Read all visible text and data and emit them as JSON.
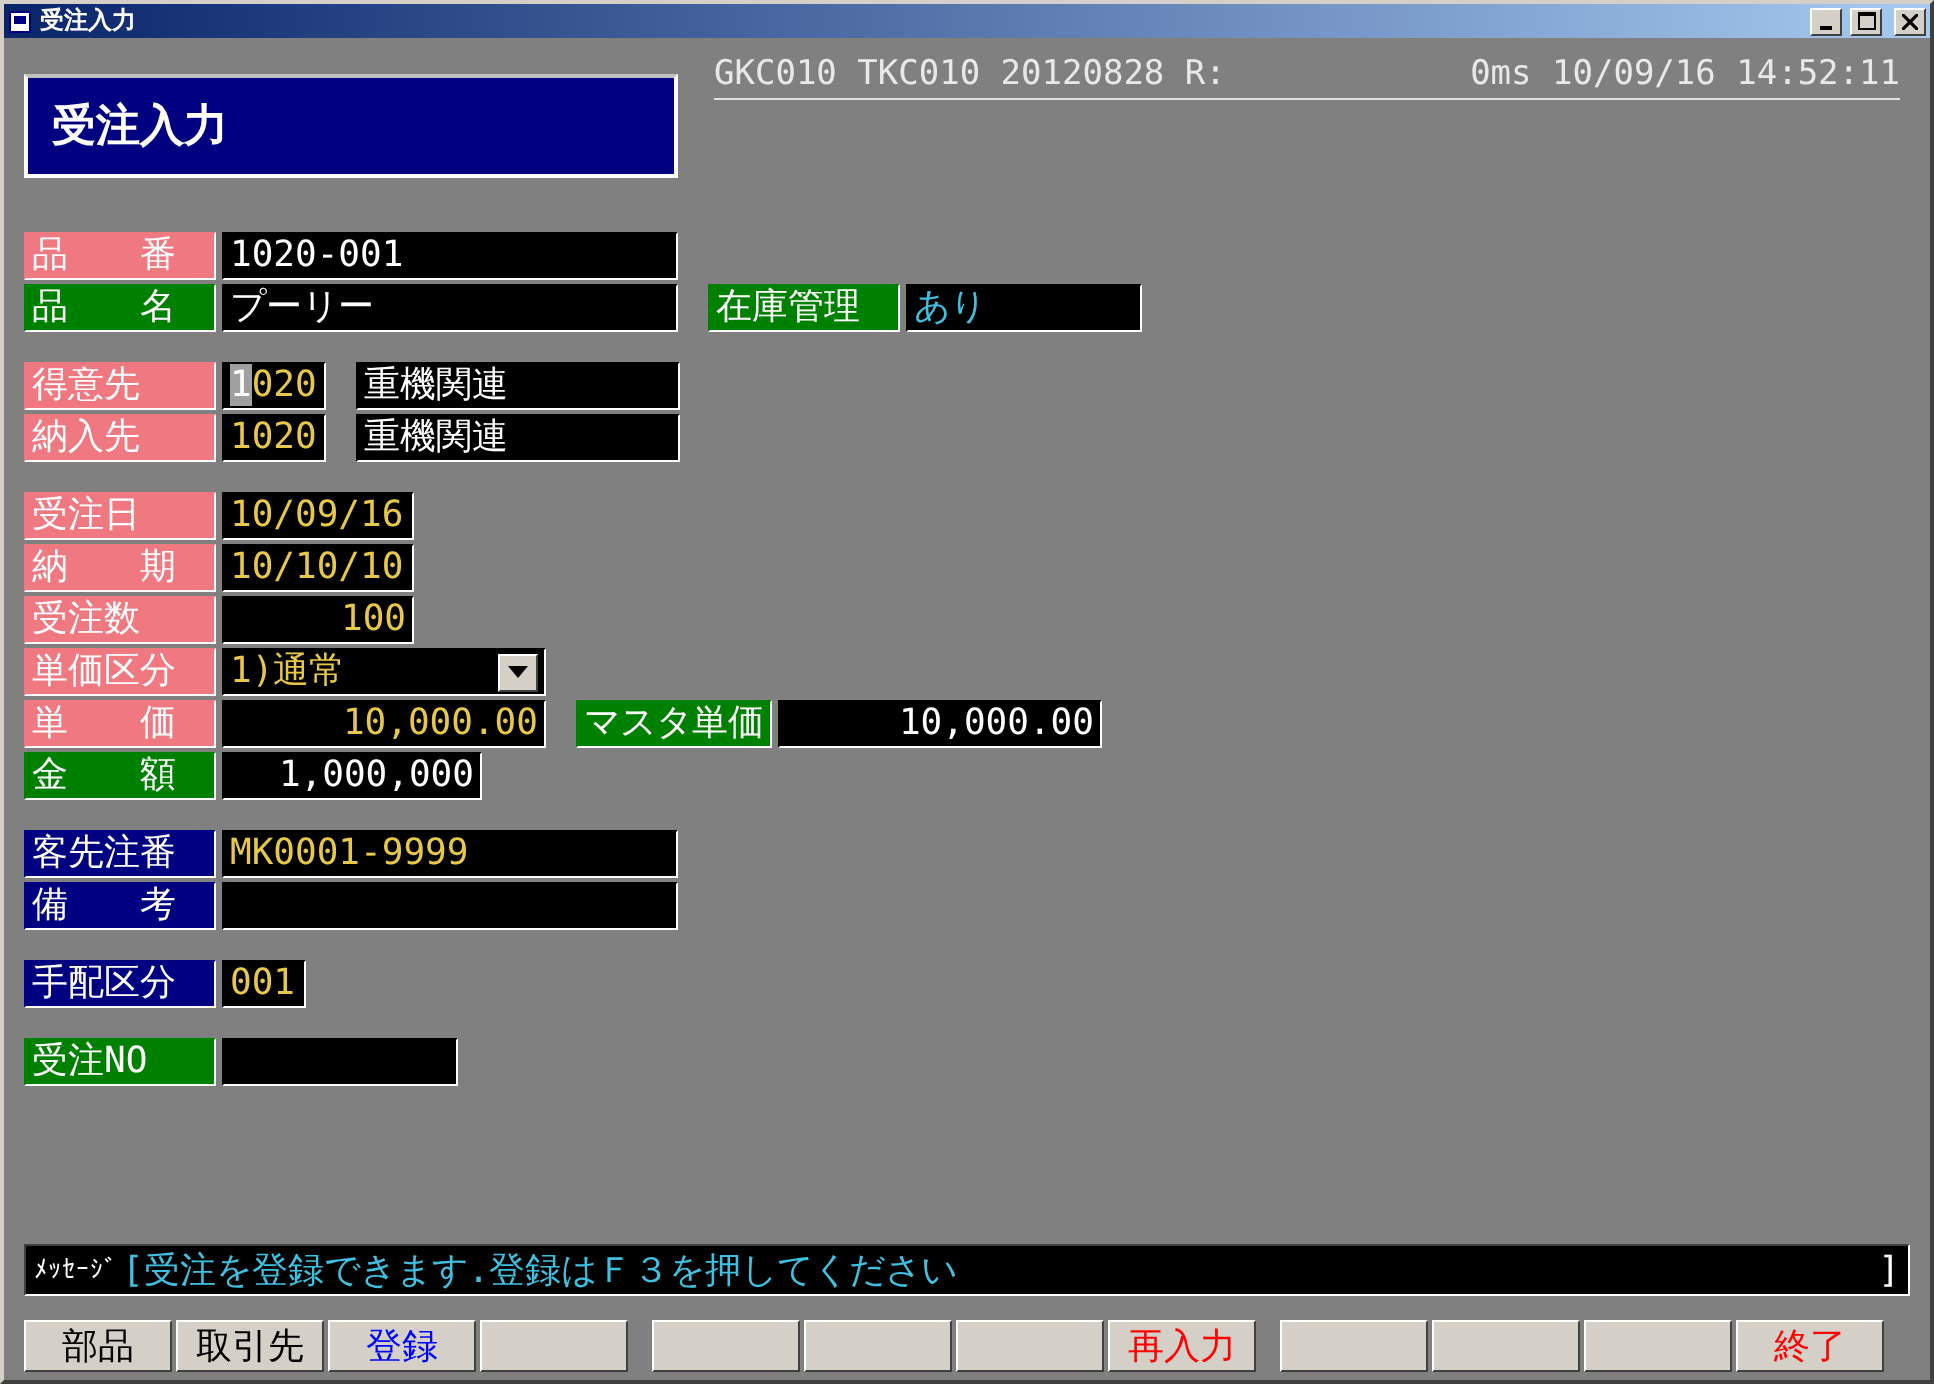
{
  "window": {
    "title": "受注入力"
  },
  "header": {
    "title": "受注入力",
    "status_left": "GKC010 TKC010 20120828 R:",
    "status_right": "0ms 10/09/16 14:52:11"
  },
  "groups": [
    [
      {
        "cells": [
          {
            "kind": "label",
            "text": "品　　番",
            "color": "#f07880"
          },
          {
            "kind": "long",
            "text": "1020-001",
            "color": "#ffffff"
          }
        ]
      },
      {
        "cells": [
          {
            "kind": "label",
            "text": "品　　名",
            "color": "#008000"
          },
          {
            "kind": "long",
            "text": "プーリー",
            "color": "#ffffff"
          },
          {
            "kind": "label",
            "text": "在庫管理",
            "color": "#008000"
          },
          {
            "kind": "flag",
            "text": "あり",
            "color": "#40c0e0"
          }
        ]
      }
    ],
    [
      {
        "cells": [
          {
            "kind": "label",
            "text": "得意先",
            "color": "#f07880"
          },
          {
            "kind": "code",
            "text": "1020",
            "color": "#e8c848",
            "cursor": true
          },
          {
            "kind": "name",
            "text": "重機関連",
            "color": "#ffffff"
          }
        ]
      },
      {
        "cells": [
          {
            "kind": "label",
            "text": "納入先",
            "color": "#f07880"
          },
          {
            "kind": "code",
            "text": "1020",
            "color": "#e8c848",
            "cursor": false
          },
          {
            "kind": "name",
            "text": "重機関連",
            "color": "#ffffff"
          }
        ]
      }
    ],
    [
      {
        "cells": [
          {
            "kind": "label",
            "text": "受注日",
            "color": "#f07880"
          },
          {
            "kind": "date",
            "text": "10/09/16",
            "color": "#e8c848"
          }
        ]
      },
      {
        "cells": [
          {
            "kind": "label",
            "text": "納　　期",
            "color": "#f07880"
          },
          {
            "kind": "date",
            "text": "10/10/10",
            "color": "#e8c848"
          }
        ]
      },
      {
        "cells": [
          {
            "kind": "label",
            "text": "受注数",
            "color": "#f07880"
          },
          {
            "kind": "quantity",
            "text": "100",
            "color": "#e8c848"
          }
        ]
      },
      {
        "cells": [
          {
            "kind": "label",
            "text": "単価区分",
            "color": "#f07880"
          },
          {
            "kind": "select",
            "text": "1)通常",
            "color": "#e8c848"
          }
        ]
      },
      {
        "cells": [
          {
            "kind": "label",
            "text": "単　　価",
            "color": "#f07880"
          },
          {
            "kind": "price",
            "text": "10,000.00",
            "color": "#e8c848"
          },
          {
            "kind": "label",
            "text": "マスタ単価",
            "color": "#008000"
          },
          {
            "kind": "price",
            "text": "10,000.00",
            "color": "#ffffff"
          }
        ]
      },
      {
        "cells": [
          {
            "kind": "label",
            "text": "金　　額",
            "color": "#008000"
          },
          {
            "kind": "total",
            "text": "1,000,000",
            "color": "#ffffff"
          }
        ]
      }
    ],
    [
      {
        "cells": [
          {
            "kind": "label",
            "text": "客先注番",
            "color": "#000080"
          },
          {
            "kind": "long",
            "text": "MK0001-9999",
            "color": "#e8c848"
          }
        ]
      },
      {
        "cells": [
          {
            "kind": "label",
            "text": "備　　考",
            "color": "#000080"
          },
          {
            "kind": "long"
          }
        ]
      }
    ],
    [
      {
        "cells": [
          {
            "kind": "label",
            "text": "手配区分",
            "color": "#000080"
          },
          {
            "kind": "short",
            "text": "001",
            "color": "#e8c848"
          }
        ]
      }
    ],
    [
      {
        "cells": [
          {
            "kind": "label",
            "text": "受注NO",
            "color": "#008000"
          },
          {
            "kind": "flag"
          }
        ]
      }
    ]
  ],
  "message": {
    "label": "ﾒｯｾｰｼﾞ",
    "open": "[",
    "text": "受注を登録できます.登録はＦ３を押してください",
    "close": "]"
  },
  "function_keys": [
    [
      {
        "kind": "key",
        "label": "部品",
        "color": "#000000"
      },
      {
        "kind": "key",
        "label": "取引先",
        "color": "#000000"
      },
      {
        "kind": "key",
        "label": "登録",
        "color": "#0000ff"
      },
      {
        "kind": "blank"
      }
    ],
    [
      {
        "kind": "blank"
      },
      {
        "kind": "blank"
      },
      {
        "kind": "blank"
      },
      {
        "kind": "key",
        "label": "再入力",
        "color": "#ff0000"
      }
    ],
    [
      {
        "kind": "blank"
      },
      {
        "kind": "blank"
      },
      {
        "kind": "blank"
      },
      {
        "kind": "key",
        "label": "終了",
        "color": "#ff0000"
      }
    ]
  ]
}
